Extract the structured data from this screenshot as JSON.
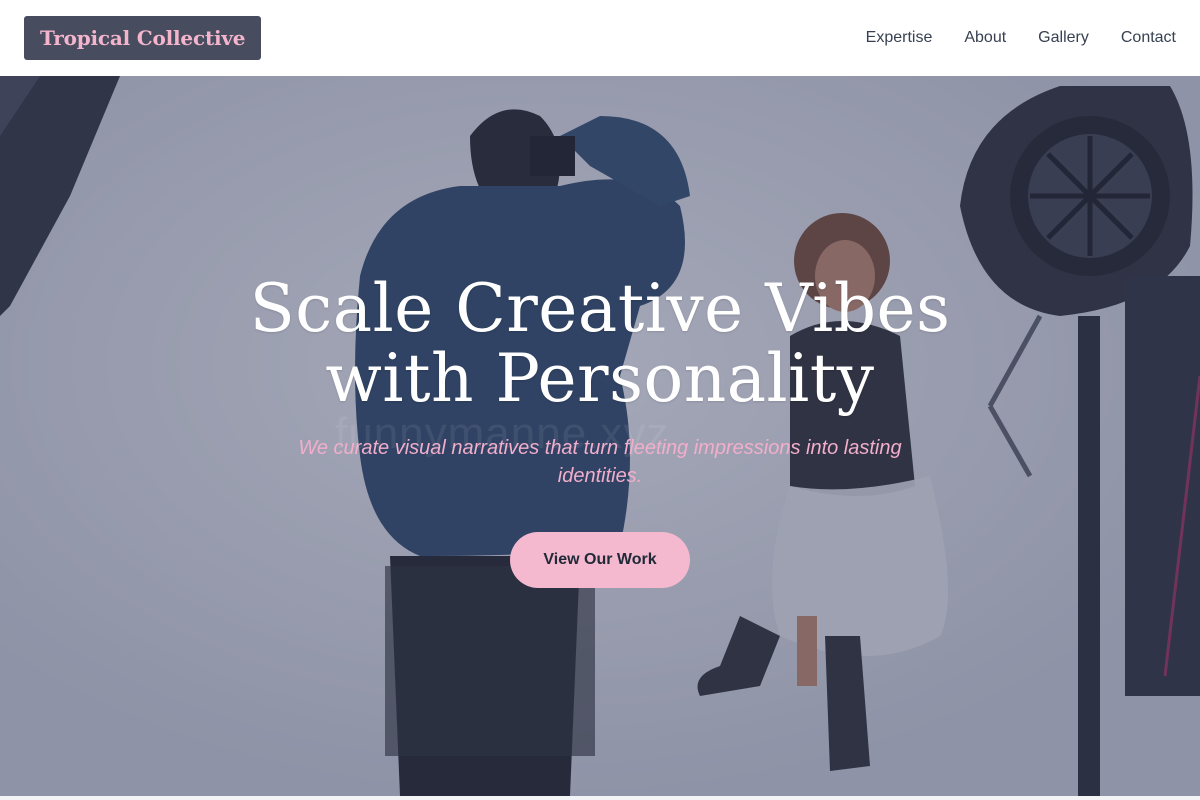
{
  "header": {
    "brand": "Tropical Collective",
    "nav": [
      {
        "label": "Expertise"
      },
      {
        "label": "About"
      },
      {
        "label": "Gallery"
      },
      {
        "label": "Contact"
      }
    ]
  },
  "hero": {
    "title_line1": "Scale Creative Vibes",
    "title_line2": "with Personality",
    "subtitle": "We curate visual narratives that turn fleeting impressions into lasting identities.",
    "cta_label": "View Our Work",
    "watermark": "funnymanne.xyz",
    "photo_description_icon": "photo-shoot-image"
  },
  "colors": {
    "brand_bg": "#474d5f",
    "brand_text": "#f3b4cc",
    "accent_pink": "#f4b8cf",
    "subtitle_pink": "#f2aecb",
    "nav_text": "#374151"
  }
}
